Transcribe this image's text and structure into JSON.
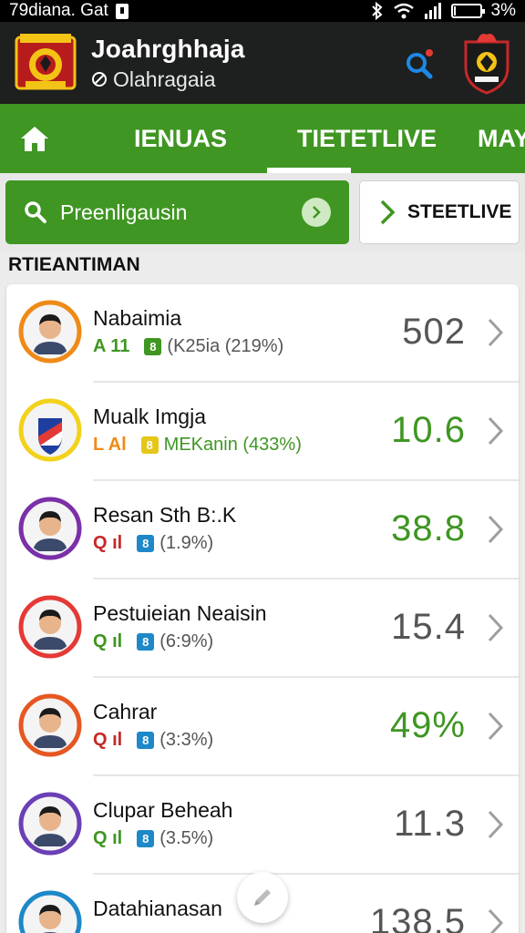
{
  "status_bar": {
    "left_text": "79diana. Gat",
    "battery_text": "3%",
    "battery_level": 0.03
  },
  "app_bar": {
    "title": "Joahrghhaja",
    "subtitle": "Olahragaia",
    "subtitle_icon": "no-sign-icon",
    "search_icon": "search-icon",
    "accent_color": "#e53935"
  },
  "tabs": {
    "home_icon": "home-icon",
    "items": [
      "IENUAS",
      "TIETETLIVE",
      "MAY"
    ],
    "active_index": 1
  },
  "search": {
    "label": "Preenligausin",
    "live_label": "STEETLIVE"
  },
  "section": {
    "title": "RTIEANTIMAN"
  },
  "list": {
    "rows": [
      {
        "name": "Nabaimia",
        "code": "A 11",
        "code_color": "#3f9622",
        "box_char": "8",
        "box_color": "#3f9622",
        "detail": "(K25ia (219%)",
        "detail_color": "#555555",
        "value": "502",
        "value_color": "#555555",
        "ring_color": "#ef8a17",
        "avatar_icon": "person-avatar-icon"
      },
      {
        "name": "Mualk Imgja",
        "code": "L Al",
        "code_color": "#ef8a17",
        "box_char": "8",
        "box_color": "#e6c619",
        "detail": "MEKanin (433%)",
        "detail_color": "#3f9622",
        "value": "10.6",
        "value_color": "#3f9622",
        "ring_color": "#f2d21b",
        "avatar_icon": "shield-avatar-icon"
      },
      {
        "name": "Resan Sth B:.K",
        "code": "Q ıl",
        "code_color": "#c62828",
        "box_char": "8",
        "box_color": "#1e88c8",
        "detail": "(1.9%)",
        "detail_color": "#555555",
        "value": "38.8",
        "value_color": "#3f9622",
        "ring_color": "#7b2fa8",
        "avatar_icon": "person-avatar-icon"
      },
      {
        "name": "Pestuieian Neaisin",
        "code": "Q ıl",
        "code_color": "#3f9622",
        "box_char": "8",
        "box_color": "#1e88c8",
        "detail": "(6:9%)",
        "detail_color": "#555555",
        "value": "15.4",
        "value_color": "#555555",
        "ring_color": "#e53935",
        "avatar_icon": "athlete-avatar-icon"
      },
      {
        "name": "Cahrar",
        "code": "Q ıl",
        "code_color": "#c62828",
        "box_char": "8",
        "box_color": "#1e88c8",
        "detail": "(3:3%)",
        "detail_color": "#555555",
        "value": "49%",
        "value_color": "#3f9622",
        "ring_color": "#e65722",
        "avatar_icon": "cricketer-avatar-icon"
      },
      {
        "name": "Clupar Beheah",
        "code": "Q ıl",
        "code_color": "#3f9622",
        "box_char": "8",
        "box_color": "#1e88c8",
        "detail": "(3.5%)",
        "detail_color": "#555555",
        "value": "11.3",
        "value_color": "#555555",
        "ring_color": "#6b3fb5",
        "avatar_icon": "batsman-avatar-icon"
      },
      {
        "name": "Datahianasan",
        "code": "",
        "code_color": "#3f9622",
        "box_char": "",
        "box_color": "#1e88c8",
        "detail": "",
        "detail_color": "#555555",
        "value": "138.5",
        "value_color": "#555555",
        "ring_color": "#1e88c8",
        "avatar_icon": "person-avatar-icon"
      }
    ]
  },
  "fab": {
    "icon": "edit-icon"
  }
}
